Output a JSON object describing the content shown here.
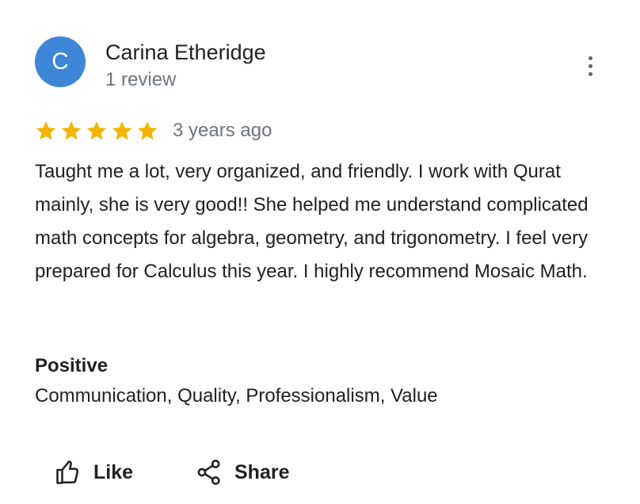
{
  "review": {
    "author": {
      "avatar_letter": "C",
      "avatar_color": "#3d86d8",
      "name": "Carina Etheridge",
      "review_count": "1 review"
    },
    "menu_icon": "more-vertical-icon",
    "rating": 5,
    "rating_max": 5,
    "star_color": "#f4b400",
    "date": "3 years ago",
    "text": "Taught me a lot, very organized, and friendly. I work with Qurat mainly, she is very good!! She helped me understand complicated math concepts for algebra, geometry, and trigonometry. I feel very prepared for Calculus this year. I highly recommend Mosaic Math.",
    "positive": {
      "heading": "Positive",
      "values": "Communication, Quality, Professionalism, Value"
    }
  },
  "actions": {
    "like": {
      "icon": "thumbs-up-icon",
      "label": "Like"
    },
    "share": {
      "icon": "share-icon",
      "label": "Share"
    }
  }
}
